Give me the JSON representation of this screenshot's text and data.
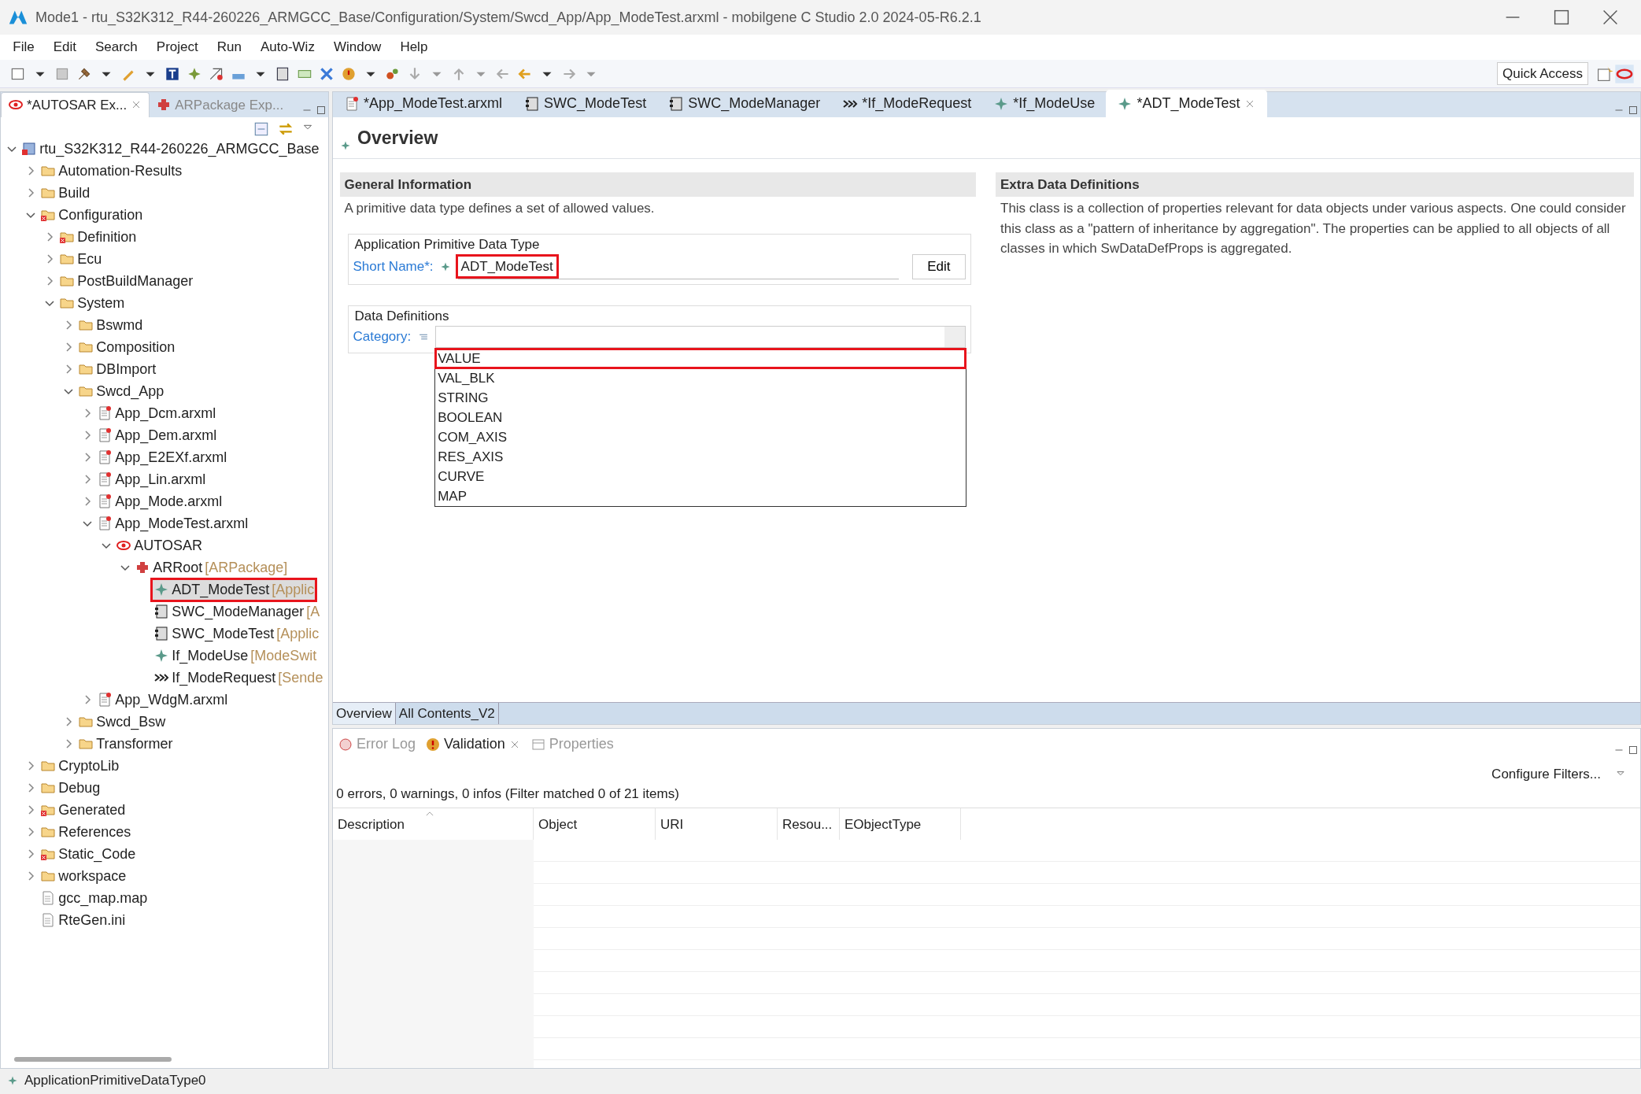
{
  "window": {
    "title": "Mode1 - rtu_S32K312_R44-260226_ARMGCC_Base/Configuration/System/Swcd_App/App_ModeTest.arxml - mobilgene C Studio 2.0 2024-05-R6.2.1"
  },
  "menu": [
    "File",
    "Edit",
    "Search",
    "Project",
    "Run",
    "Auto-Wiz",
    "Window",
    "Help"
  ],
  "quick_access": {
    "label": "Quick Access"
  },
  "left_panel": {
    "tabs": [
      {
        "label": "*AUTOSAR Ex...",
        "selected": true,
        "kind": "autosar"
      },
      {
        "label": "ARPackage Exp...",
        "selected": false,
        "kind": "package"
      }
    ],
    "tree": [
      {
        "label": "rtu_S32K312_R44-260226_ARMGCC_Base",
        "kind": "project",
        "expanded": true,
        "selected": false,
        "children": [
          {
            "label": "Automation-Results",
            "kind": "folder",
            "expanded": false,
            "selected": false
          },
          {
            "label": "Build",
            "kind": "folder",
            "expanded": false,
            "selected": false
          },
          {
            "label": "Configuration",
            "kind": "errfolder",
            "expanded": true,
            "selected": false,
            "children": [
              {
                "label": "Definition",
                "kind": "errfolder",
                "expanded": false,
                "selected": false
              },
              {
                "label": "Ecu",
                "kind": "folder",
                "expanded": false,
                "selected": false
              },
              {
                "label": "PostBuildManager",
                "kind": "folder",
                "expanded": false,
                "selected": false
              },
              {
                "label": "System",
                "kind": "folder",
                "expanded": true,
                "selected": false,
                "children": [
                  {
                    "label": "Bswmd",
                    "kind": "folder",
                    "expanded": false,
                    "selected": false
                  },
                  {
                    "label": "Composition",
                    "kind": "folder",
                    "expanded": false,
                    "selected": false
                  },
                  {
                    "label": "DBImport",
                    "kind": "folder",
                    "expanded": false,
                    "selected": false
                  },
                  {
                    "label": "Swcd_App",
                    "kind": "folder",
                    "expanded": true,
                    "selected": false,
                    "children": [
                      {
                        "label": "App_Dcm.arxml",
                        "kind": "arxml",
                        "expanded": false,
                        "selected": false
                      },
                      {
                        "label": "App_Dem.arxml",
                        "kind": "arxml",
                        "expanded": false,
                        "selected": false
                      },
                      {
                        "label": "App_E2EXf.arxml",
                        "kind": "arxml",
                        "expanded": false,
                        "selected": false
                      },
                      {
                        "label": "App_Lin.arxml",
                        "kind": "arxml",
                        "expanded": false,
                        "selected": false
                      },
                      {
                        "label": "App_Mode.arxml",
                        "kind": "arxml",
                        "expanded": false,
                        "selected": false
                      },
                      {
                        "label": "App_ModeTest.arxml",
                        "kind": "arxml",
                        "expanded": true,
                        "selected": false,
                        "children": [
                          {
                            "label": "AUTOSAR",
                            "kind": "autosar",
                            "expanded": true,
                            "selected": false,
                            "children": [
                              {
                                "label": "ARRoot",
                                "type": "[ARPackage]",
                                "kind": "package",
                                "expanded": true,
                                "selected": false,
                                "children": [
                                  {
                                    "label": "ADT_ModeTest",
                                    "type": "[Applic",
                                    "kind": "datatype",
                                    "selected": true
                                  },
                                  {
                                    "label": "SWC_ModeManager",
                                    "type": "[A",
                                    "kind": "component",
                                    "selected": false
                                  },
                                  {
                                    "label": "SWC_ModeTest",
                                    "type": "[Applic",
                                    "kind": "component",
                                    "selected": false
                                  },
                                  {
                                    "label": "If_ModeUse",
                                    "type": "[ModeSwit",
                                    "kind": "datatype",
                                    "selected": false
                                  },
                                  {
                                    "label": "If_ModeRequest",
                                    "type": "[Sende",
                                    "kind": "interface",
                                    "selected": false
                                  }
                                ]
                              }
                            ]
                          }
                        ]
                      },
                      {
                        "label": "App_WdgM.arxml",
                        "kind": "arxml",
                        "expanded": false,
                        "selected": false
                      }
                    ]
                  },
                  {
                    "label": "Swcd_Bsw",
                    "kind": "folder",
                    "expanded": false,
                    "selected": false
                  },
                  {
                    "label": "Transformer",
                    "kind": "folder",
                    "expanded": false,
                    "selected": false
                  }
                ]
              }
            ]
          },
          {
            "label": "CryptoLib",
            "kind": "folder",
            "expanded": false,
            "selected": false
          },
          {
            "label": "Debug",
            "kind": "folder",
            "expanded": false,
            "selected": false
          },
          {
            "label": "Generated",
            "kind": "errfolder",
            "expanded": false,
            "selected": false
          },
          {
            "label": "References",
            "kind": "folder",
            "expanded": false,
            "selected": false
          },
          {
            "label": "Static_Code",
            "kind": "errfolder",
            "expanded": false,
            "selected": false
          },
          {
            "label": "workspace",
            "kind": "folder",
            "expanded": false,
            "selected": false
          },
          {
            "label": "gcc_map.map",
            "kind": "file",
            "selected": false
          },
          {
            "label": "RteGen.ini",
            "kind": "file",
            "selected": false
          }
        ]
      }
    ]
  },
  "editor": {
    "tabs": [
      {
        "label": "*App_ModeTest.arxml",
        "kind": "arxml",
        "selected": false
      },
      {
        "label": "SWC_ModeTest",
        "kind": "component",
        "selected": false
      },
      {
        "label": "SWC_ModeManager",
        "kind": "component",
        "selected": false
      },
      {
        "label": "*If_ModeRequest",
        "kind": "interface",
        "selected": false
      },
      {
        "label": "*If_ModeUse",
        "kind": "datatype",
        "selected": false
      },
      {
        "label": "*ADT_ModeTest",
        "kind": "datatype",
        "selected": true
      }
    ],
    "heading": "Overview",
    "general": {
      "title": "General Information",
      "description": "A primitive data type defines a set of allowed values.",
      "group": "Application Primitive Data Type",
      "short_name_label": "Short Name*:",
      "short_name": "ADT_ModeTest",
      "marked": true,
      "edit_button": "Edit",
      "data_group": "Data Definitions",
      "category_label": "Category:",
      "category_options": [
        {
          "label": "VALUE",
          "selected": true
        },
        {
          "label": "VAL_BLK",
          "selected": false
        },
        {
          "label": "STRING",
          "selected": false
        },
        {
          "label": "BOOLEAN",
          "selected": false
        },
        {
          "label": "COM_AXIS",
          "selected": false
        },
        {
          "label": "RES_AXIS",
          "selected": false
        },
        {
          "label": "CURVE",
          "selected": false
        },
        {
          "label": "MAP",
          "selected": false
        }
      ]
    },
    "extra": {
      "title": "Extra Data Definitions",
      "description": "This class is a collection of properties relevant for data objects under various aspects. One could consider this class as a \"pattern of inheritance by aggregation\". The properties can be applied to all objects of all classes in which SwDataDefProps is aggregated."
    },
    "page_tabs": [
      {
        "label": "Overview",
        "selected": true
      },
      {
        "label": "All Contents_V2",
        "selected": false
      }
    ]
  },
  "bottom_panel": {
    "tabs": [
      {
        "label": "Error Log",
        "kind": "errorlog",
        "selected": false
      },
      {
        "label": "Validation",
        "kind": "validation",
        "selected": true
      },
      {
        "label": "Properties",
        "kind": "properties",
        "selected": false
      }
    ],
    "configure": "Configure Filters...",
    "summary": "0 errors, 0 warnings, 0 infos (Filter matched 0 of 21 items)",
    "columns": [
      "Description",
      "Object",
      "URI",
      "Resou...",
      "EObjectType"
    ]
  },
  "status_bar": {
    "text": "ApplicationPrimitiveDataType0"
  }
}
